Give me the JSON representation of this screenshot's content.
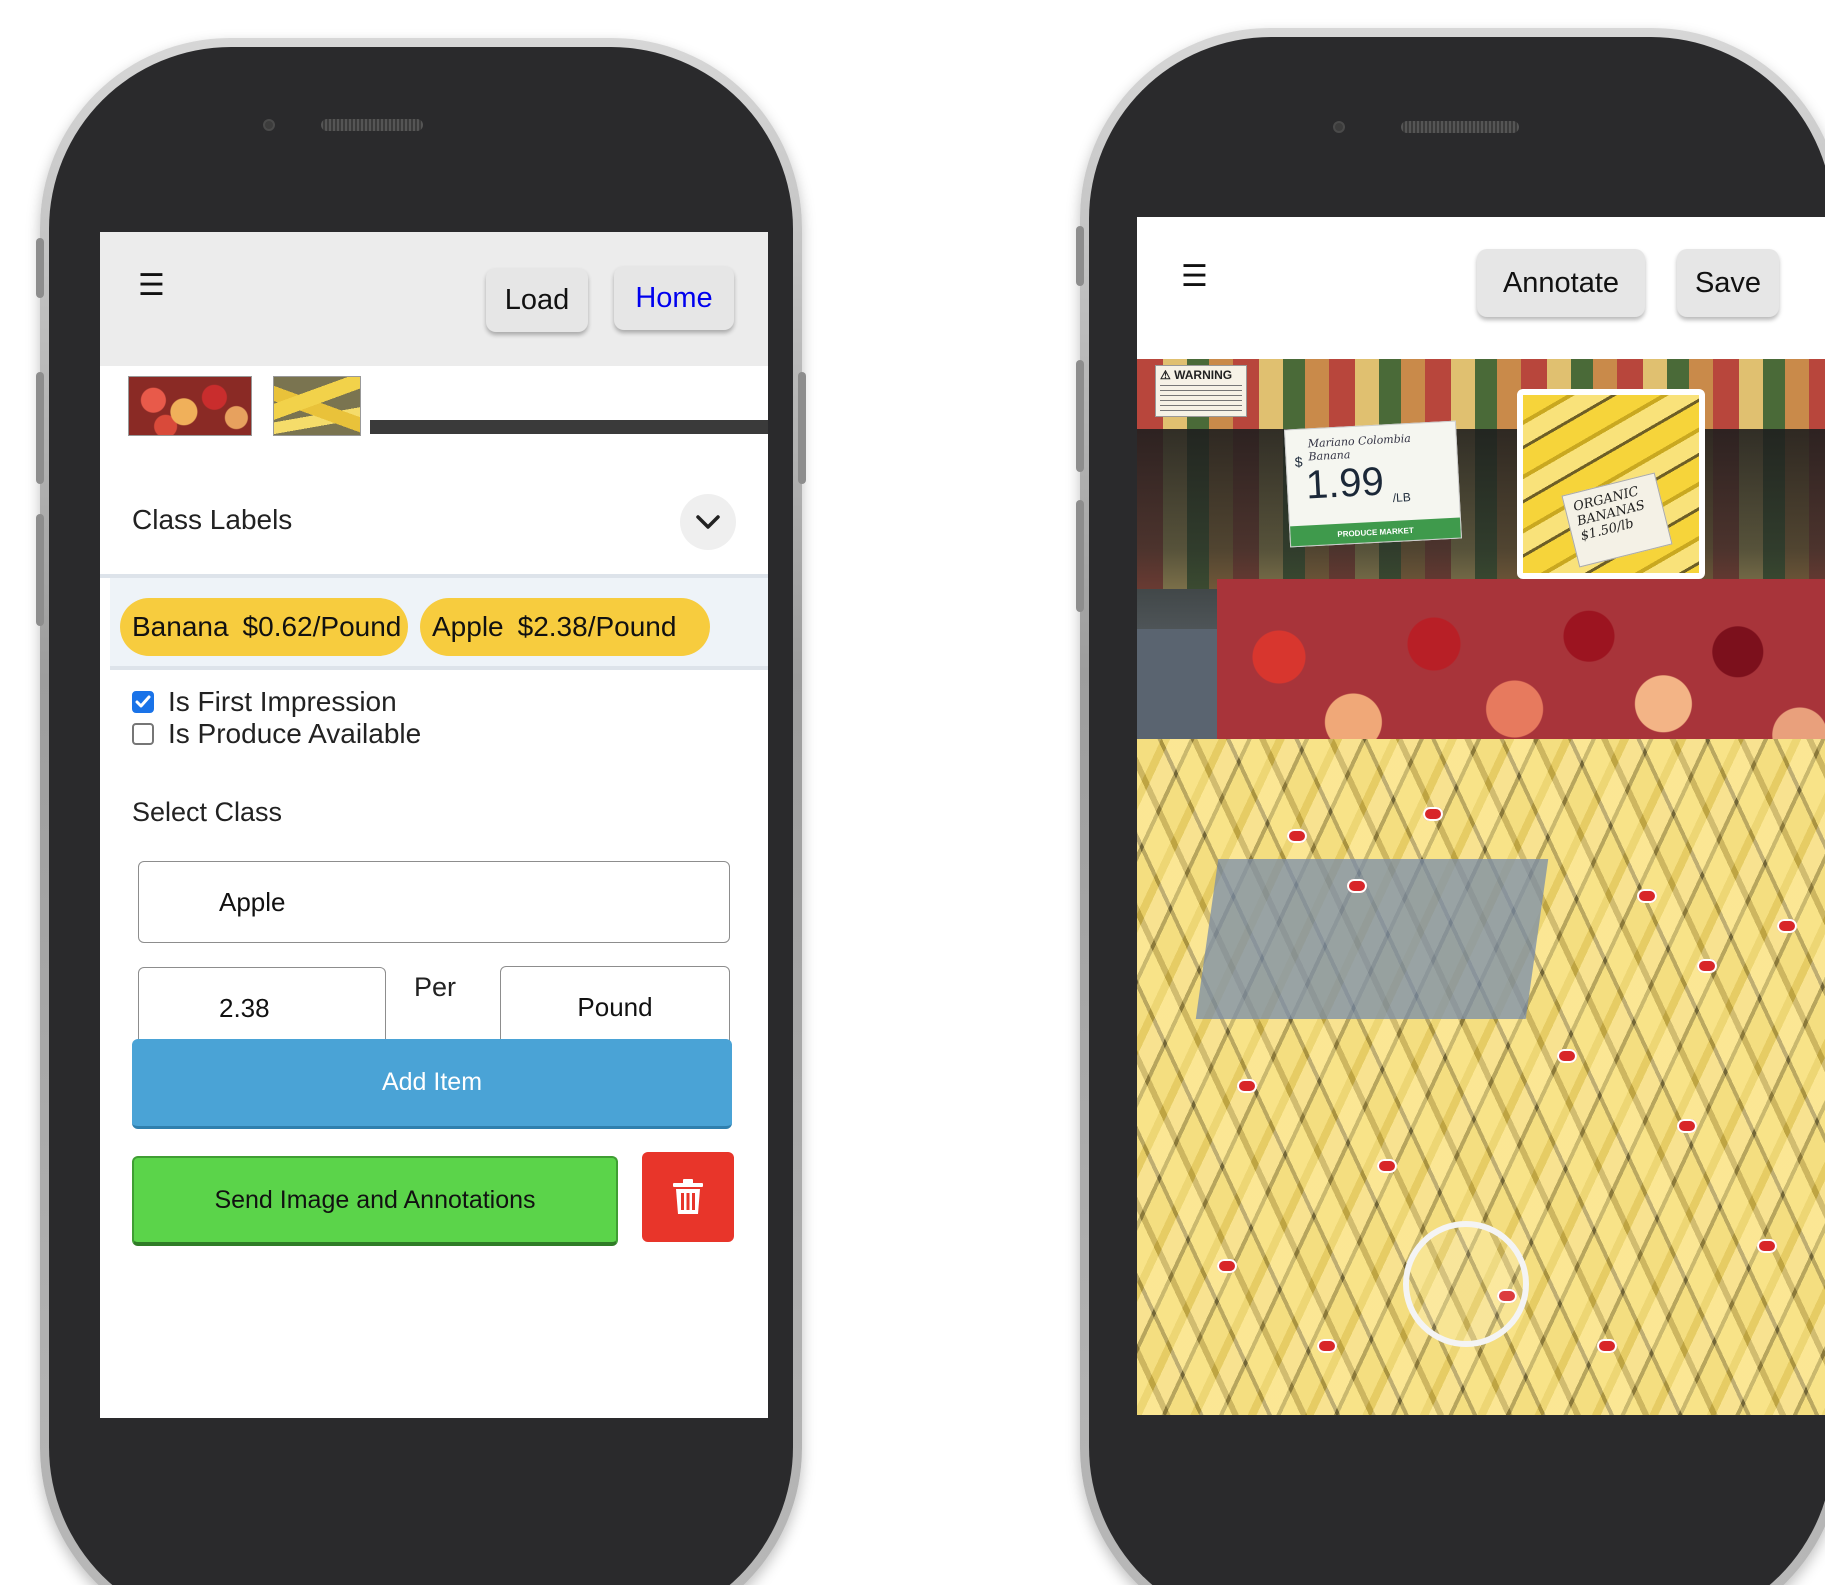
{
  "left_app": {
    "header": {
      "menu_icon": "hamburger-menu-icon",
      "load_label": "Load",
      "home_label": "Home",
      "home_color": "#0000ee"
    },
    "thumbnails": [
      {
        "name": "apples-thumbnail"
      },
      {
        "name": "bananas-thumbnail"
      }
    ],
    "panel": {
      "title": "Class Labels",
      "collapse_icon": "chevron-down-icon",
      "chips": [
        {
          "name": "Banana",
          "price": "$0.62/Pound"
        },
        {
          "name": "Apple",
          "price": "$2.38/Pound"
        }
      ],
      "chip_color": "#f7cc3e",
      "first_impression": {
        "label": "Is First Impression",
        "checked": true
      },
      "produce_available": {
        "label": "Is Produce Available",
        "checked": false
      },
      "select_class_label": "Select Class",
      "class_value": "Apple",
      "price_value": "2.38",
      "per_label": "Per",
      "unit_value": "Pound",
      "add_item_label": "Add Item",
      "send_label": "Send Image and Annotations",
      "delete_icon": "trash-icon",
      "colors": {
        "add": "#4aa3d6",
        "send": "#5bd44a",
        "delete": "#e8352a"
      }
    }
  },
  "right_app": {
    "header": {
      "menu_icon": "hamburger-menu-icon",
      "annotate_label": "Annotate",
      "save_label": "Save"
    },
    "photo": {
      "warning_text": "⚠ WARNING",
      "sign_script": "Mariano Colombia Banana",
      "sign_dollar": "$",
      "sign_price": "1.99",
      "sign_unit": "/LB",
      "sign_footer": "PRODUCE MARKET",
      "preview_tag": "ORGANIC BANANAS $1.50/lb"
    },
    "shutter_icon": "shutter-button-icon"
  }
}
